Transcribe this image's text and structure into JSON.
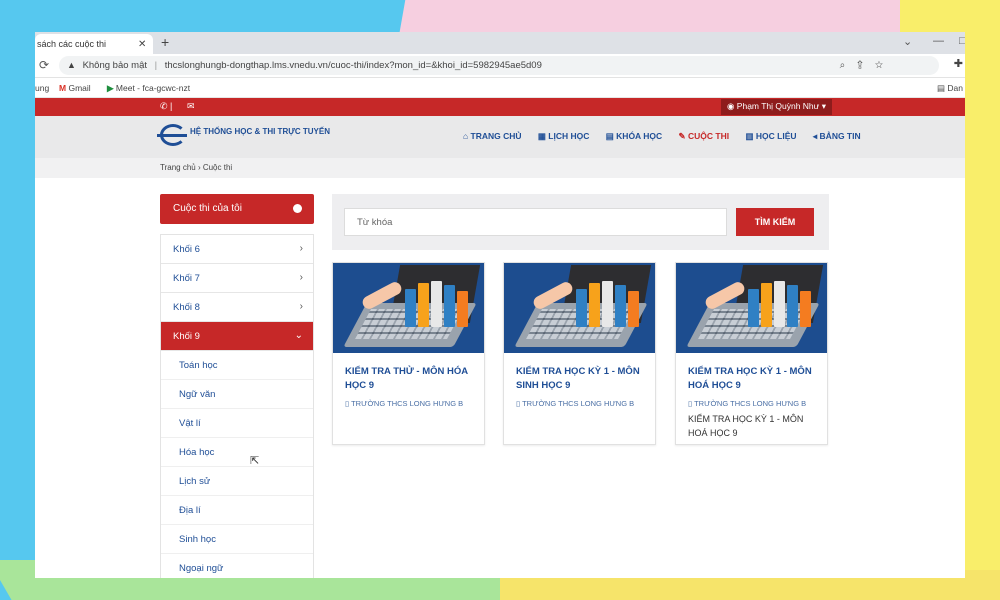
{
  "browser": {
    "tab_title": "sách các cuộc thi",
    "tab_close": "✕",
    "new_tab": "+",
    "window_controls": [
      "⌄",
      "—",
      "□"
    ],
    "security_label": "Không bảo mật",
    "url": "thcslonghungb-dongthap.lms.vnedu.vn/cuoc-thi/index?mon_id=&khoi_id=5982945ae5d09",
    "bookmarks": {
      "partial": "ung",
      "gmail": "Gmail",
      "meet": "Meet - fca-gcwc-nzt",
      "right_partial": "Dan"
    }
  },
  "site": {
    "user_name": "Phạm Thị Quỳnh Như",
    "logo_text": "HỆ THỐNG HỌC & THI TRỰC TUYẾN",
    "nav": [
      {
        "icon": "⌂",
        "label": "TRANG CHỦ"
      },
      {
        "icon": "▦",
        "label": "LỊCH HỌC"
      },
      {
        "icon": "▤",
        "label": "KHÓA HỌC"
      },
      {
        "icon": "✎",
        "label": "CUỘC THI"
      },
      {
        "icon": "▥",
        "label": "HỌC LIỆU"
      },
      {
        "icon": "◂",
        "label": "BẢNG TIN"
      }
    ],
    "breadcrumb": "Trang chủ  ›  Cuộc thi"
  },
  "sidebar": {
    "header": "Cuộc thi của tôi",
    "grades": [
      "Khối 6",
      "Khối 7",
      "Khối 8",
      "Khối 9"
    ],
    "subjects": [
      "Toán học",
      "Ngữ văn",
      "Vật lí",
      "Hóa học",
      "Lịch sử",
      "Địa lí",
      "Sinh học",
      "Ngoại ngữ"
    ]
  },
  "search": {
    "placeholder": "Từ khóa",
    "button": "TÌM KIẾM"
  },
  "cards": [
    {
      "title": "KIỂM TRA THỬ - MÔN HÓA HỌC 9",
      "school": "TRƯỜNG THCS LONG HƯNG B",
      "description": ""
    },
    {
      "title": "KIỂM TRA HỌC KỲ 1 - MÔN SINH HỌC 9",
      "school": "TRƯỜNG THCS LONG HƯNG B",
      "description": ""
    },
    {
      "title": "KIỂM TRA HỌC KỲ 1 - MÔN HOÁ HỌC 9",
      "school": "TRƯỜNG THCS LONG HƯNG B",
      "description": "KIỂM TRA HỌC KỲ 1 - MÔN HOÁ HỌC 9"
    }
  ],
  "colors": {
    "brand_red": "#c62828",
    "brand_blue": "#1f4e96",
    "book_colors": [
      "#2f80c4",
      "#f7a21b",
      "#e8e8e8",
      "#2f80c4",
      "#f47c20"
    ]
  }
}
